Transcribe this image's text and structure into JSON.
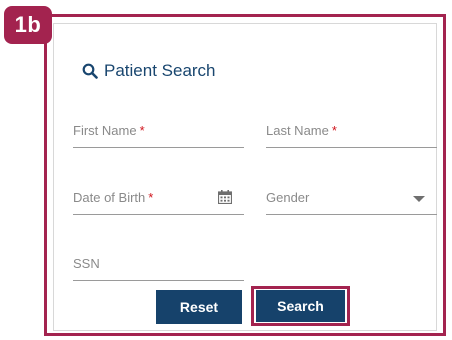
{
  "badge": {
    "label": "1b"
  },
  "panel": {
    "title": "Patient Search",
    "title_icon": "search-icon",
    "accent_color": "#a3234f",
    "brand_color": "#16426b"
  },
  "form": {
    "first_name": {
      "label": "First Name",
      "required_mark": "*"
    },
    "last_name": {
      "label": "Last Name",
      "required_mark": "*"
    },
    "date_of_birth": {
      "label": "Date of Birth",
      "required_mark": "*",
      "icon": "calendar-icon"
    },
    "gender": {
      "label": "Gender",
      "icon": "caret-down-icon"
    },
    "ssn": {
      "label": "SSN"
    }
  },
  "actions": {
    "reset_label": "Reset",
    "search_label": "Search"
  }
}
